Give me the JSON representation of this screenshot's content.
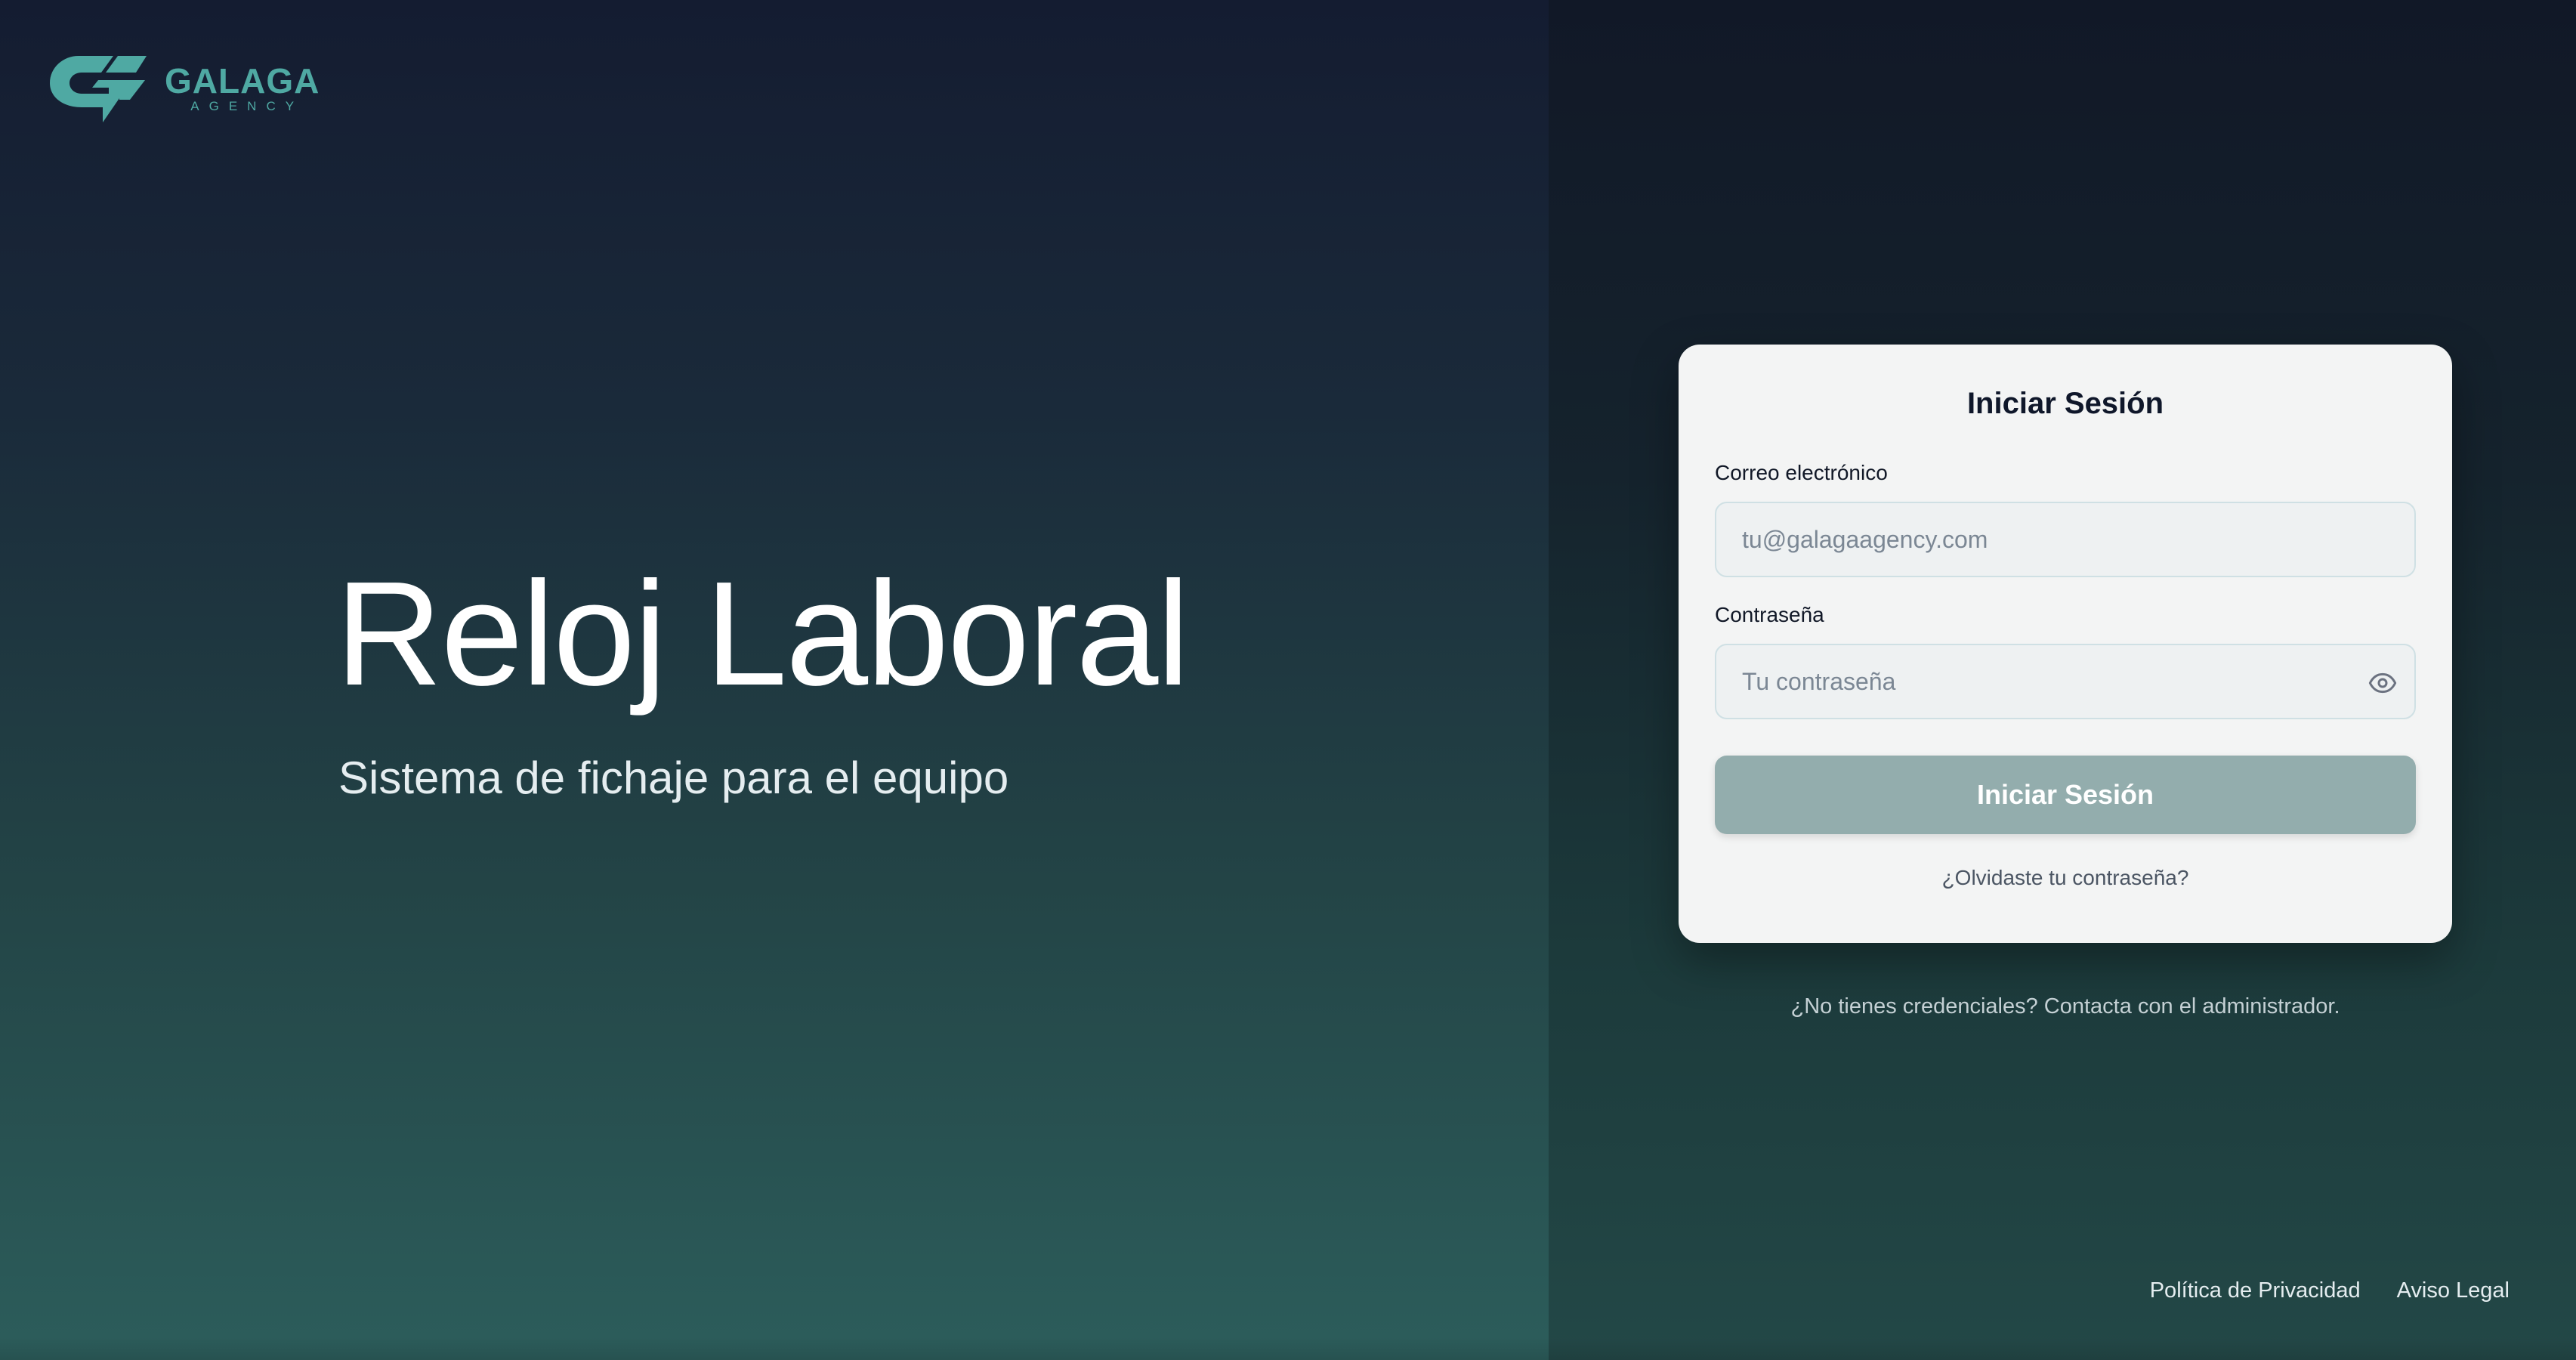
{
  "brand": {
    "name": "GALAGA",
    "tagline": "AGENCY",
    "color": "#4fa9a3",
    "logo_icon": "galaga-logo-icon"
  },
  "hero": {
    "title": "Reloj Laboral",
    "subtitle": "Sistema de fichaje para el equipo"
  },
  "login": {
    "title": "Iniciar Sesión",
    "email_label": "Correo electrónico",
    "email_placeholder": "tu@galagaagency.com",
    "email_value": "",
    "password_label": "Contraseña",
    "password_placeholder": "Tu contraseña",
    "password_value": "",
    "password_toggle_icon": "eye-icon",
    "submit_label": "Iniciar Sesión",
    "forgot_label": "¿Olvidaste tu contraseña?"
  },
  "notice": "¿No tienes credenciales? Contacta con el administrador.",
  "footer": {
    "privacy_label": "Política de Privacidad",
    "legal_label": "Aviso Legal"
  },
  "colors": {
    "button_bg": "#93adad",
    "card_bg": "#f3f4f4"
  }
}
